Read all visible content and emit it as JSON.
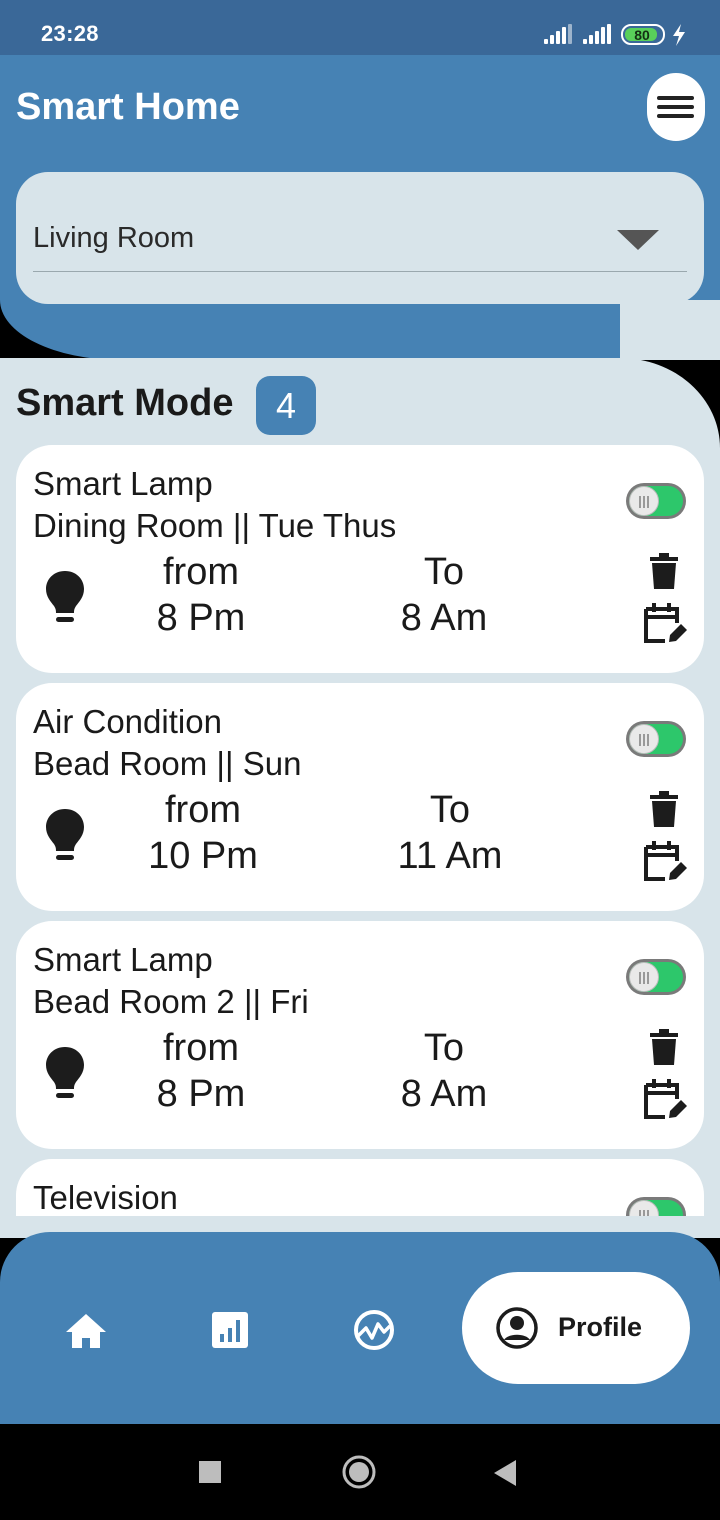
{
  "status_bar": {
    "time": "23:28",
    "battery": "80"
  },
  "header": {
    "title": "Smart Home"
  },
  "room_selector": {
    "value": "Living Room"
  },
  "section": {
    "title": "Smart Mode",
    "count": "4"
  },
  "cards": [
    {
      "device": "Smart Lamp",
      "room_days": "Dining Room || Tue Thus",
      "from_label": "from",
      "from_time": "8 Pm",
      "to_label": "To",
      "to_time": "8 Am",
      "enabled": true
    },
    {
      "device": "Air Condition",
      "room_days": "Bead Room || Sun",
      "from_label": "from",
      "from_time": "10 Pm",
      "to_label": "To",
      "to_time": "11 Am",
      "enabled": true
    },
    {
      "device": "Smart Lamp",
      "room_days": "Bead Room 2 || Fri",
      "from_label": "from",
      "from_time": "8 Pm",
      "to_label": "To",
      "to_time": "8 Am",
      "enabled": true
    },
    {
      "device": "Television",
      "room_days": "",
      "from_label": "",
      "from_time": "",
      "to_label": "",
      "to_time": "",
      "enabled": true
    }
  ],
  "bottom_nav": {
    "items": [
      {
        "icon": "home-icon"
      },
      {
        "icon": "bar-chart-icon"
      },
      {
        "icon": "activity-icon"
      },
      {
        "icon": "account-circle-icon",
        "label": "Profile",
        "active": true
      }
    ]
  },
  "colors": {
    "primary": "#4682b4",
    "background": "#d8e4ea",
    "toggle_on": "#2dc76b"
  }
}
